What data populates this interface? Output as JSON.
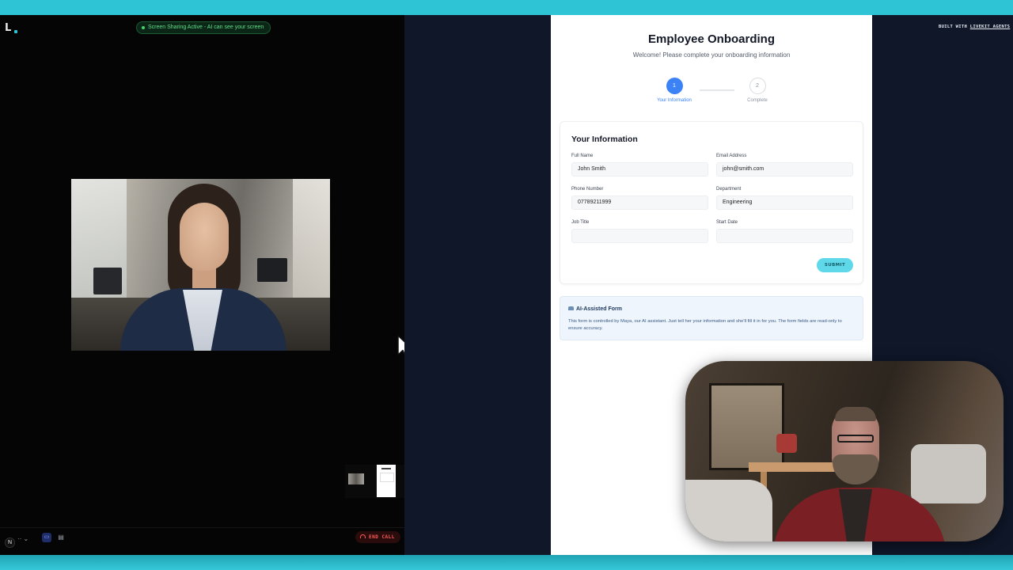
{
  "left_panel": {
    "logo": "L",
    "share_badge": "Screen Sharing Active - AI can see your screen",
    "controls": {
      "avatar_letter": "N",
      "mic_label": "·· ⌄",
      "end_call_label": "END CALL"
    }
  },
  "form": {
    "title": "Employee Onboarding",
    "subtitle": "Welcome! Please complete your onboarding information",
    "steps": [
      {
        "number": "1",
        "label": "Your Information"
      },
      {
        "number": "2",
        "label": "Complete"
      }
    ],
    "card_title": "Your Information",
    "fields": {
      "full_name": {
        "label": "Full Name",
        "value": "John Smith"
      },
      "email": {
        "label": "Email Address",
        "value": "john@smith.com"
      },
      "phone": {
        "label": "Phone Number",
        "value": "07789211999"
      },
      "department": {
        "label": "Department",
        "value": "Engineering"
      },
      "job_title": {
        "label": "Job Title",
        "value": ""
      },
      "start_date": {
        "label": "Start Date",
        "value": ""
      }
    },
    "submit_label": "SUBMIT",
    "info": {
      "title": "AI-Assisted Form",
      "text": "This form is controlled by Maya, our AI assistant. Just tell her your information and she'll fill it in for you. The form fields are read-only to ensure accuracy."
    }
  },
  "branding": {
    "prefix": "BUILT WITH ",
    "name": "LIVEKIT AGENTS"
  },
  "colors": {
    "accent": "#3b82f6",
    "submit": "#5fd9ea",
    "end_call": "#ff5a5a",
    "share_active": "#5fe08a",
    "frame": "#2ec4d6"
  }
}
